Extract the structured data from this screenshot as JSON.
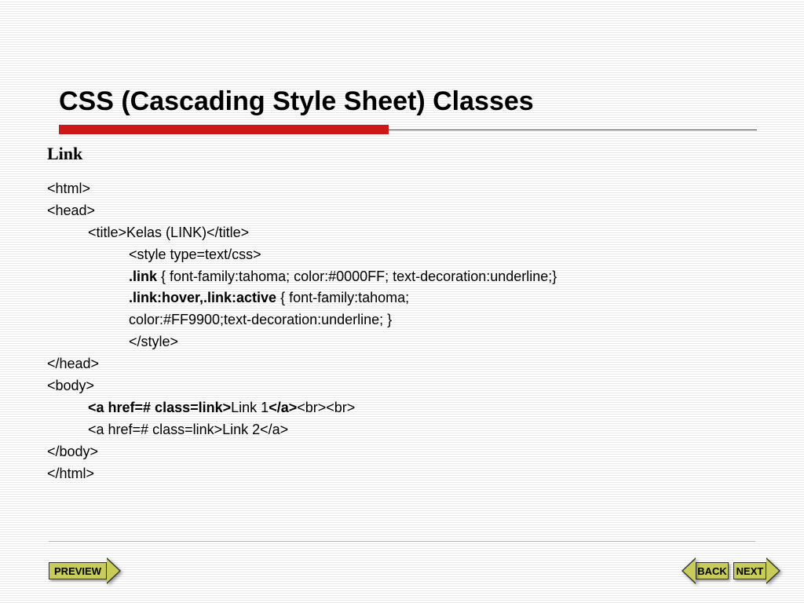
{
  "title": "CSS (Cascading Style Sheet) Classes",
  "subtitle": "Link",
  "code": {
    "l1": "<html>",
    "l2": "<head>",
    "l3": "<title>Kelas (LINK)</title>",
    "l4": "<style type=text/css>",
    "l5a": ".link",
    "l5b": " { font-family:tahoma; color:#0000FF;  text-decoration:underline;}",
    "l6a": ".link:hover,.link:active",
    "l6b": " { font-family:tahoma;",
    "l7": "color:#FF9900;text-decoration:underline; }",
    "l8": "</style>",
    "l9": "</head>",
    "l10": "<body>",
    "l11a": "<a href=# class=link>",
    "l11b": "Link 1",
    "l11c": "</a>",
    "l11d": "<br><br>",
    "l12": "<a href=# class=link>Link 2</a>",
    "l13": "</body>",
    "l14": "</html>"
  },
  "nav": {
    "preview": "PREVIEW",
    "back": "BACK",
    "next": "NEXT"
  }
}
